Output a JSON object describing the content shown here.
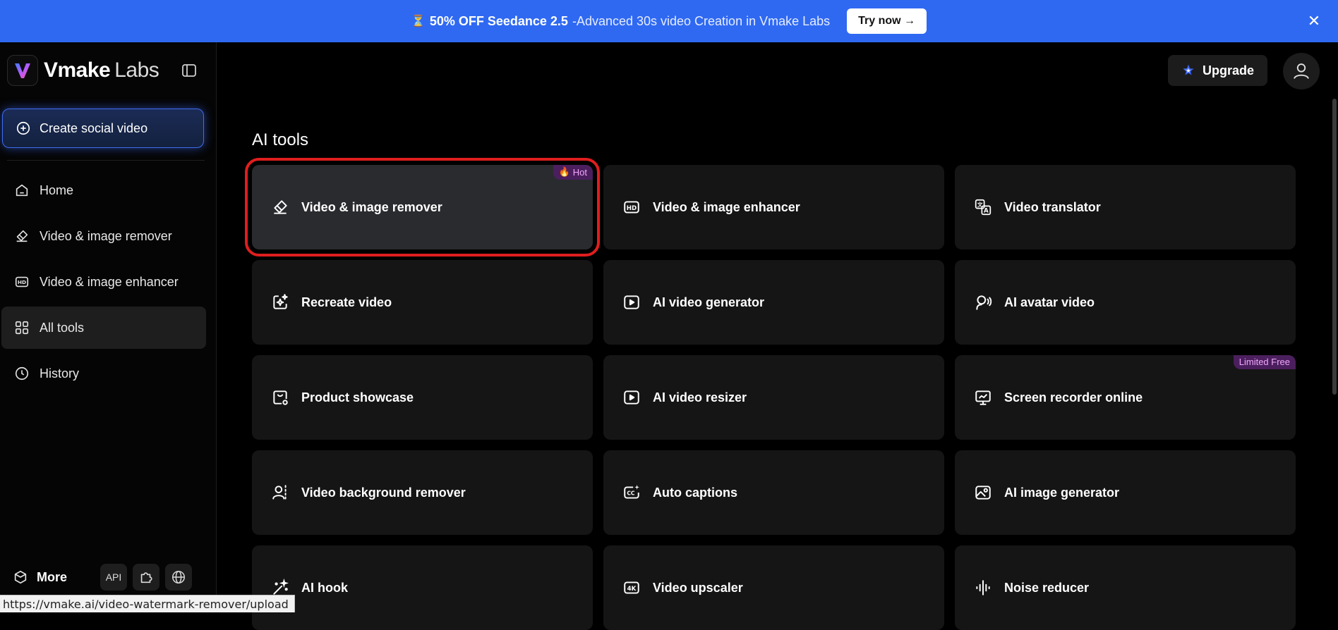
{
  "banner": {
    "hourglass": "⏳",
    "promo_bold": "50% OFF Seedance 2.5",
    "promo_rest": "-Advanced 30s video Creation in Vmake Labs",
    "try_label": "Try now →",
    "close": "✕"
  },
  "sidebar": {
    "brand": "Vmake",
    "brand_suffix": "Labs",
    "create_label": "Create social video",
    "nav": [
      {
        "label": "Home",
        "icon": "home-icon"
      },
      {
        "label": "Video & image remover",
        "icon": "eraser-icon"
      },
      {
        "label": "Video & image enhancer",
        "icon": "hd-icon"
      },
      {
        "label": "All tools",
        "icon": "grid-icon",
        "active": true
      },
      {
        "label": "History",
        "icon": "clock-icon"
      }
    ],
    "more_label": "More",
    "api_label": "API"
  },
  "header": {
    "upgrade_label": "Upgrade"
  },
  "main": {
    "section_title": "AI tools",
    "tools": [
      {
        "label": "Video & image remover",
        "icon": "eraser-icon",
        "badge": "Hot",
        "selected": true
      },
      {
        "label": "Video & image enhancer",
        "icon": "hd-icon"
      },
      {
        "label": "Video translator",
        "icon": "translate-icon"
      },
      {
        "label": "Recreate video",
        "icon": "sparkle-frame-icon"
      },
      {
        "label": "AI video generator",
        "icon": "play-icon"
      },
      {
        "label": "AI avatar video",
        "icon": "avatar-icon"
      },
      {
        "label": "Product showcase",
        "icon": "bag-icon"
      },
      {
        "label": "AI video resizer",
        "icon": "play-icon"
      },
      {
        "label": "Screen recorder online",
        "icon": "monitor-chart-icon",
        "badge": "Limited Free"
      },
      {
        "label": "Video background remover",
        "icon": "person-cutout-icon"
      },
      {
        "label": "Auto captions",
        "icon": "cc-icon"
      },
      {
        "label": "AI image generator",
        "icon": "image-icon"
      },
      {
        "label": "AI hook",
        "icon": "magic-wand-icon"
      },
      {
        "label": "Video upscaler",
        "icon": "4k-icon"
      },
      {
        "label": "Noise reducer",
        "icon": "waveform-icon"
      }
    ]
  },
  "status_url": "https://vmake.ai/video-watermark-remover/upload",
  "colors": {
    "banner": "#2f69f2",
    "accent_border": "#3f6df0",
    "selection_outline": "#e01e1e",
    "badge_bg": "#4b1f5e",
    "badge_text": "#f2a7ff"
  }
}
